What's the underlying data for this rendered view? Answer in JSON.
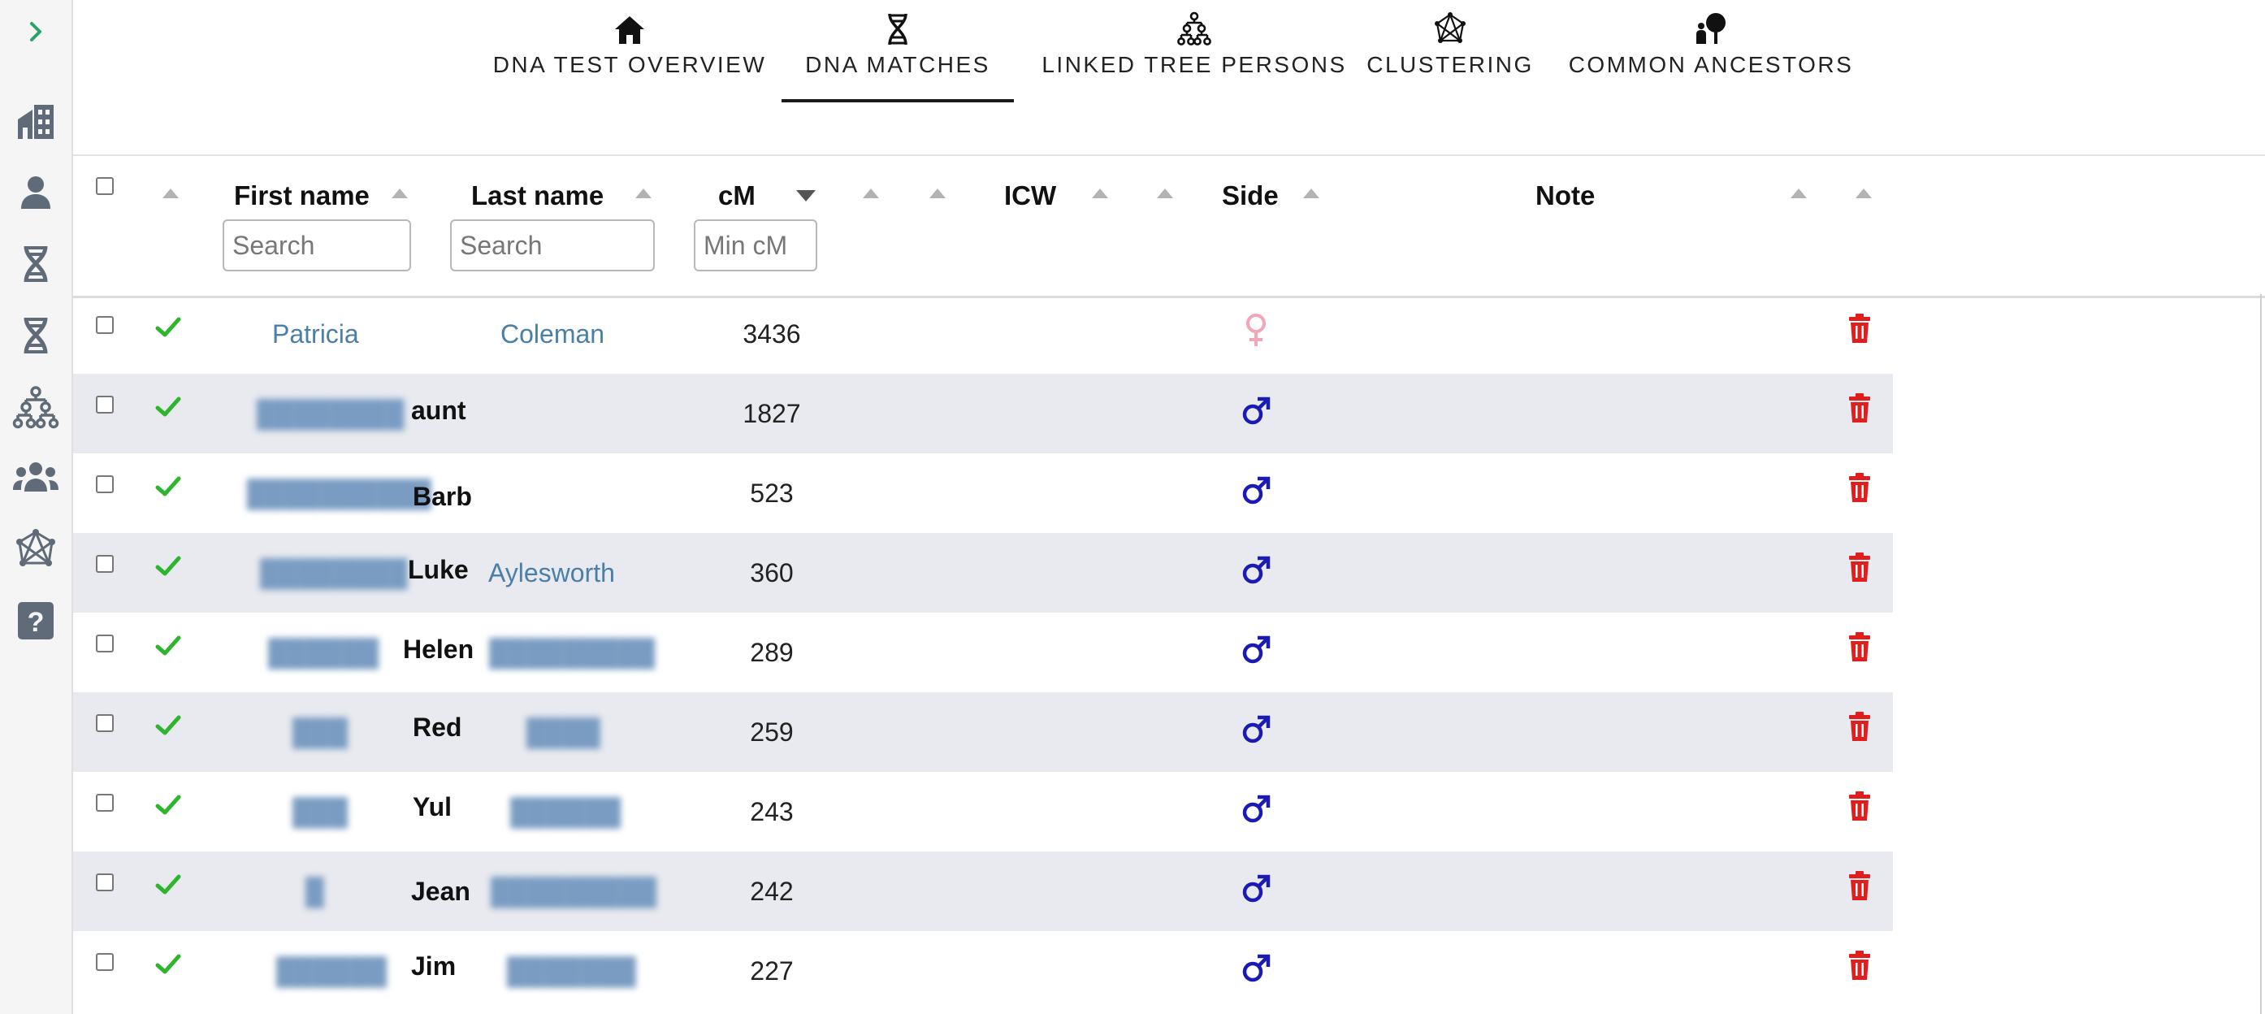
{
  "sidebar": {
    "items": [
      {
        "icon": "chevron-right-icon"
      },
      {
        "icon": "buildings-icon"
      },
      {
        "icon": "person-icon"
      },
      {
        "icon": "dna-icon"
      },
      {
        "icon": "dna-icon"
      },
      {
        "icon": "family-tree-icon"
      },
      {
        "icon": "group-icon"
      },
      {
        "icon": "network-icon"
      },
      {
        "icon": "help-icon"
      }
    ]
  },
  "tabs": [
    {
      "label": "DNA TEST OVERVIEW",
      "icon": "home-icon"
    },
    {
      "label": "DNA MATCHES",
      "icon": "dna-icon",
      "active": true
    },
    {
      "label": "LINKED TREE PERSONS",
      "icon": "family-tree-icon"
    },
    {
      "label": "CLUSTERING",
      "icon": "network-icon"
    },
    {
      "label": "COMMON ANCESTORS",
      "icon": "ancestor-tree-icon"
    }
  ],
  "table": {
    "columns": {
      "first_name": "First name",
      "last_name": "Last name",
      "cm": "cM",
      "icw": "ICW",
      "side": "Side",
      "note": "Note"
    },
    "filters": {
      "first_name_placeholder": "Search",
      "last_name_placeholder": "Search",
      "cm_placeholder": "Min cM"
    },
    "rows": [
      {
        "first": "Patricia",
        "last": "Coleman",
        "cm": "3436",
        "side": "female"
      },
      {
        "first": "aunt",
        "cm": "1827",
        "side": "male"
      },
      {
        "first": "Barb",
        "cm": "523",
        "side": "male"
      },
      {
        "first": "Luke",
        "last": "Aylesworth",
        "cm": "360",
        "side": "male"
      },
      {
        "first": "Helen",
        "cm": "289",
        "side": "male"
      },
      {
        "first": "Red",
        "cm": "259",
        "side": "male"
      },
      {
        "first": "Yul",
        "cm": "243",
        "side": "male"
      },
      {
        "first": "Jean",
        "cm": "242",
        "side": "male"
      },
      {
        "first": "Jim",
        "cm": "227",
        "side": "male"
      }
    ]
  },
  "colors": {
    "link": "#4a7fa7",
    "check": "#2db52d",
    "male": "#1a1ab4",
    "female": "#f2a6b8",
    "delete": "#e01e1e",
    "row_alt": "#e8eaef"
  }
}
